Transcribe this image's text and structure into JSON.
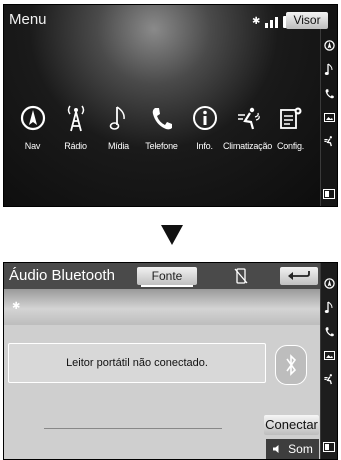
{
  "screen1": {
    "title": "Menu",
    "visor_label": "Visor",
    "items": [
      {
        "label": "Nav",
        "icon": "compass-icon"
      },
      {
        "label": "Rádio",
        "icon": "radio-tower-icon"
      },
      {
        "label": "Mídia",
        "icon": "music-note-icon"
      },
      {
        "label": "Telefone",
        "icon": "phone-icon"
      },
      {
        "label": "Info.",
        "icon": "info-icon"
      },
      {
        "label": "Climatização",
        "icon": "climate-icon"
      },
      {
        "label": "Config.",
        "icon": "settings-icon"
      }
    ],
    "side_icons": [
      "compass-icon",
      "music-note-icon",
      "phone-icon",
      "image-icon",
      "climate-icon",
      "display-toggle-icon"
    ]
  },
  "screen2": {
    "title": "Áudio Bluetooth",
    "fonte_label": "Fonte",
    "message": "Leitor portátil não conectado.",
    "conectar_label": "Conectar",
    "som_label": "Som",
    "side_icons": [
      "compass-icon",
      "music-note-icon",
      "phone-icon",
      "image-icon",
      "climate-icon",
      "display-toggle-icon"
    ]
  },
  "colors": {
    "screen_dark": "#0c0c0c",
    "screen_light": "#cfcfcf",
    "button_light": "#e6e6e6"
  }
}
